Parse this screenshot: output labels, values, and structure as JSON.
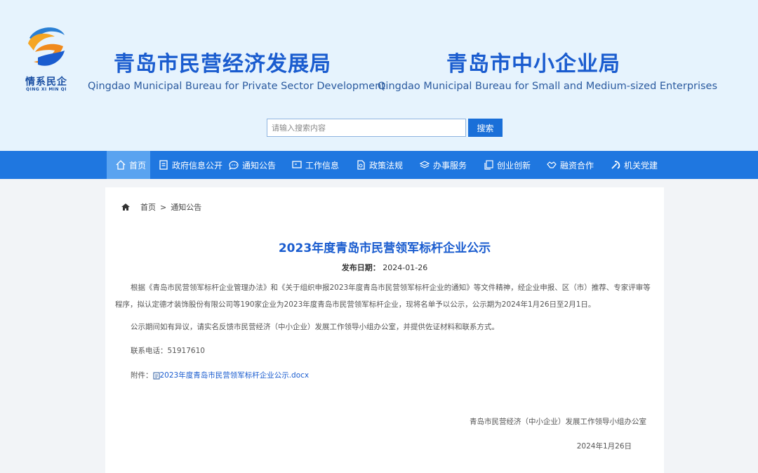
{
  "header": {
    "logo_cn": "情系民企",
    "logo_en": "QING XI MIN QI",
    "org1_cn": "青岛市民营经济发展局",
    "org1_en": "Qingdao Municipal Bureau for Private Sector Development",
    "org2_cn": "青岛市中小企业局",
    "org2_en": "Qingdao Municipal Bureau for Small and Medium-sized Enterprises",
    "colors": {
      "primary": "#1a5ccf",
      "nav": "#1f77e0",
      "nav_active": "#5aa3f0",
      "header_bg": "#e6f3fd"
    }
  },
  "search": {
    "placeholder": "请输入搜索内容",
    "button_label": "搜索"
  },
  "nav": {
    "items": [
      {
        "label": "首页",
        "icon": "home-icon",
        "active": true
      },
      {
        "label": "政府信息公开",
        "icon": "document-icon"
      },
      {
        "label": "通知公告",
        "icon": "chat-icon"
      },
      {
        "label": "工作信息",
        "icon": "monitor-icon"
      },
      {
        "label": "政策法规",
        "icon": "file-icon"
      },
      {
        "label": "办事服务",
        "icon": "layers-icon"
      },
      {
        "label": "创业创新",
        "icon": "copy-icon"
      },
      {
        "label": "融资合作",
        "icon": "handshake-icon"
      },
      {
        "label": "机关党建",
        "icon": "party-emblem-icon"
      }
    ]
  },
  "breadcrumb": {
    "home": "首页",
    "separator": ">",
    "current": "通知公告"
  },
  "article": {
    "title": "2023年度青岛市民营领军标杆企业公示",
    "date_label": "发布日期：",
    "date_value": "2024-01-26",
    "para1": "根据《青岛市民营领军标杆企业管理办法》和《关于组织申报2023年度青岛市民营领军标杆企业的通知》等文件精神，经企业申报、区（市）推荐、专家评审等程序，拟认定德才装饰股份有限公司等190家企业为2023年度青岛市民营领军标杆企业，现将名单予以公示，公示期为2024年1月26日至2月1日。",
    "para2": "公示期间如有异议，请实名反馈市民营经济（中小企业）发展工作领导小组办公室，并提供佐证材料和联系方式。",
    "phone": "联系电话：51917610",
    "attachment_label": "附件：",
    "attachment_file": "2023年度青岛市民营领军标杆企业公示.docx",
    "signature": "青岛市民营经济（中小企业）发展工作领导小组办公室",
    "sign_date": "2024年1月26日"
  }
}
